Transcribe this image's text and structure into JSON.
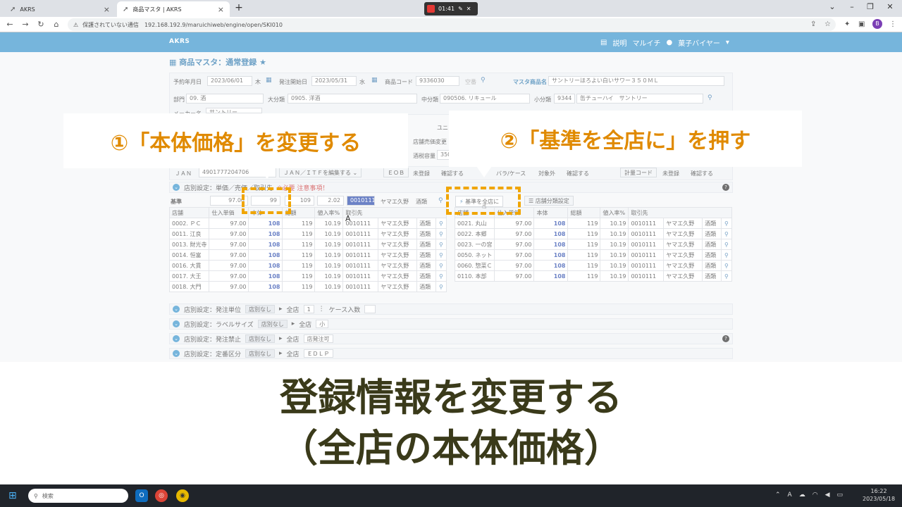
{
  "browser": {
    "tabs": [
      {
        "label": "AKRS",
        "active": false
      },
      {
        "label": "商品マスタ | AKRS",
        "active": true
      }
    ],
    "recorder_time": "01:41",
    "security_text": "保護されていない通信",
    "url": "192.168.192.9/maruichiweb/engine/open/SKI010",
    "profile_initial": "B"
  },
  "app": {
    "brand": "AKRS",
    "help_label": "説明",
    "company": "マルイチ",
    "user": "菓子バイヤー",
    "page_title": "商品マスタ：通常登録"
  },
  "form": {
    "order_date_label": "予約年月日",
    "order_date": "2023/06/01",
    "order_dow": "木",
    "start_label": "発注開始日",
    "start_date": "2023/05/31",
    "start_dow": "水",
    "code_label": "商品コード",
    "code": "9336030",
    "empty_label": "空番",
    "master_name_label": "マスタ商品名",
    "master_name": "サントリーほろよい白いサワー３５０ＭＬ",
    "dept_label": "部門",
    "dept": "09. 酒",
    "major_label": "大分類",
    "major": "0905. 洋酒",
    "mid_label": "中分類",
    "mid": "090506. リキュール",
    "minor_label": "小分類",
    "minor_code": "9344",
    "minor_name": "缶チューハイ　サントリー",
    "maker_label": "メーカー名",
    "maker": "サントリー",
    "unit_label": "ユニット",
    "price_change_label": "店舗売価変更",
    "capacity_label": "酒税容量",
    "capacity": "350"
  },
  "jan_row": {
    "jan_label": "ＪＡＮ",
    "jan_code": "4901777204706",
    "edit_label": "ＪＡＮ／ＩＴＦを編集する",
    "eob_label": "ＥＯＢ",
    "unregistered": "未登録",
    "confirm": "確認する",
    "bara_case": "バラ/ケース",
    "excluded": "対象外",
    "confirm2": "確認する",
    "weigh_code": "計量コード",
    "unregistered2": "未登録",
    "confirm3": "確認する"
  },
  "store_section": {
    "title": "店別設定：単価／売価／取引先",
    "important": "※必要 注意事項！",
    "base_label": "基準",
    "base_cost": "97.00",
    "base_price": "99",
    "base_tax": "109",
    "base_rate": "2.02",
    "base_supplier": "0010111",
    "base_supplier_name": "ヤマエ久野",
    "base_type": "酒類",
    "apply_button": "基準を全店に",
    "category_button": "店舗分類設定",
    "cursor_char": "A",
    "headers": [
      "店舗",
      "仕入単価",
      "本体",
      "総額",
      "値入率%",
      "取引先"
    ],
    "left_rows": [
      {
        "store": "0002. ＰＣ",
        "cost": "97.00",
        "price": "108",
        "tax": "119",
        "rate": "10.19",
        "sup": "0010111",
        "sup_name": "ヤマエ久野",
        "type": "酒類"
      },
      {
        "store": "0011. 江良",
        "cost": "97.00",
        "price": "108",
        "tax": "119",
        "rate": "10.19",
        "sup": "0010111",
        "sup_name": "ヤマエ久野",
        "type": "酒類"
      },
      {
        "store": "0013. 財光寺",
        "cost": "97.00",
        "price": "108",
        "tax": "119",
        "rate": "10.19",
        "sup": "0010111",
        "sup_name": "ヤマエ久野",
        "type": "酒類"
      },
      {
        "store": "0014. 恒富",
        "cost": "97.00",
        "price": "108",
        "tax": "119",
        "rate": "10.19",
        "sup": "0010111",
        "sup_name": "ヤマエ久野",
        "type": "酒類"
      },
      {
        "store": "0016. 大貫",
        "cost": "97.00",
        "price": "108",
        "tax": "119",
        "rate": "10.19",
        "sup": "0010111",
        "sup_name": "ヤマエ久野",
        "type": "酒類"
      },
      {
        "store": "0017. 大王",
        "cost": "97.00",
        "price": "108",
        "tax": "119",
        "rate": "10.19",
        "sup": "0010111",
        "sup_name": "ヤマエ久野",
        "type": "酒類"
      },
      {
        "store": "0018. 大門",
        "cost": "97.00",
        "price": "108",
        "tax": "119",
        "rate": "10.19",
        "sup": "0010111",
        "sup_name": "ヤマエ久野",
        "type": "酒類"
      }
    ],
    "right_rows": [
      {
        "store": "0021. 丸山",
        "cost": "97.00",
        "price": "108",
        "tax": "119",
        "rate": "10.19",
        "sup": "0010111",
        "sup_name": "ヤマエ久野",
        "type": "酒類"
      },
      {
        "store": "0022. 本郷",
        "cost": "97.00",
        "price": "108",
        "tax": "119",
        "rate": "10.19",
        "sup": "0010111",
        "sup_name": "ヤマエ久野",
        "type": "酒類"
      },
      {
        "store": "0023. 一の宮",
        "cost": "97.00",
        "price": "108",
        "tax": "119",
        "rate": "10.19",
        "sup": "0010111",
        "sup_name": "ヤマエ久野",
        "type": "酒類"
      },
      {
        "store": "0050. ネット",
        "cost": "97.00",
        "price": "108",
        "tax": "119",
        "rate": "10.19",
        "sup": "0010111",
        "sup_name": "ヤマエ久野",
        "type": "酒類"
      },
      {
        "store": "0060. 惣菜Ｃ",
        "cost": "97.00",
        "price": "108",
        "tax": "119",
        "rate": "10.19",
        "sup": "0010111",
        "sup_name": "ヤマエ久野",
        "type": "酒類"
      },
      {
        "store": "0110. 本部",
        "cost": "97.00",
        "price": "108",
        "tax": "119",
        "rate": "10.19",
        "sup": "0010111",
        "sup_name": "ヤマエ久野",
        "type": "酒類"
      }
    ]
  },
  "sub_sections": [
    {
      "title": "店別設定：発注単位",
      "tag": "店別なし",
      "all": "全店",
      "value": "1",
      "extra_label": "ケース入数",
      "extra_value": ""
    },
    {
      "title": "店別設定：ラベルサイズ",
      "tag": "店別なし",
      "all": "全店",
      "value": "小"
    },
    {
      "title": "店別設定：発注禁止",
      "tag": "店別なし",
      "all": "全店",
      "value": "店発注可"
    },
    {
      "title": "店別設定：定番区分",
      "tag": "店別なし",
      "all": "全店",
      "value": "ＥＤＬＰ"
    }
  ],
  "callouts": {
    "step1": "①「本体価格」を変更する",
    "step2": "②「基準を全店に」を押す"
  },
  "caption": {
    "line1": "登録情報を変更する",
    "line2": "（全店の本体価格）"
  },
  "taskbar": {
    "search_placeholder": "検索",
    "ime": "A",
    "time": "16:22",
    "date": "2023/05/18"
  },
  "colors": {
    "header_blue": "#2d8ec9",
    "callout_orange": "#e08a00",
    "highlight": "#f0a500",
    "price_blue": "#1e40a8"
  }
}
